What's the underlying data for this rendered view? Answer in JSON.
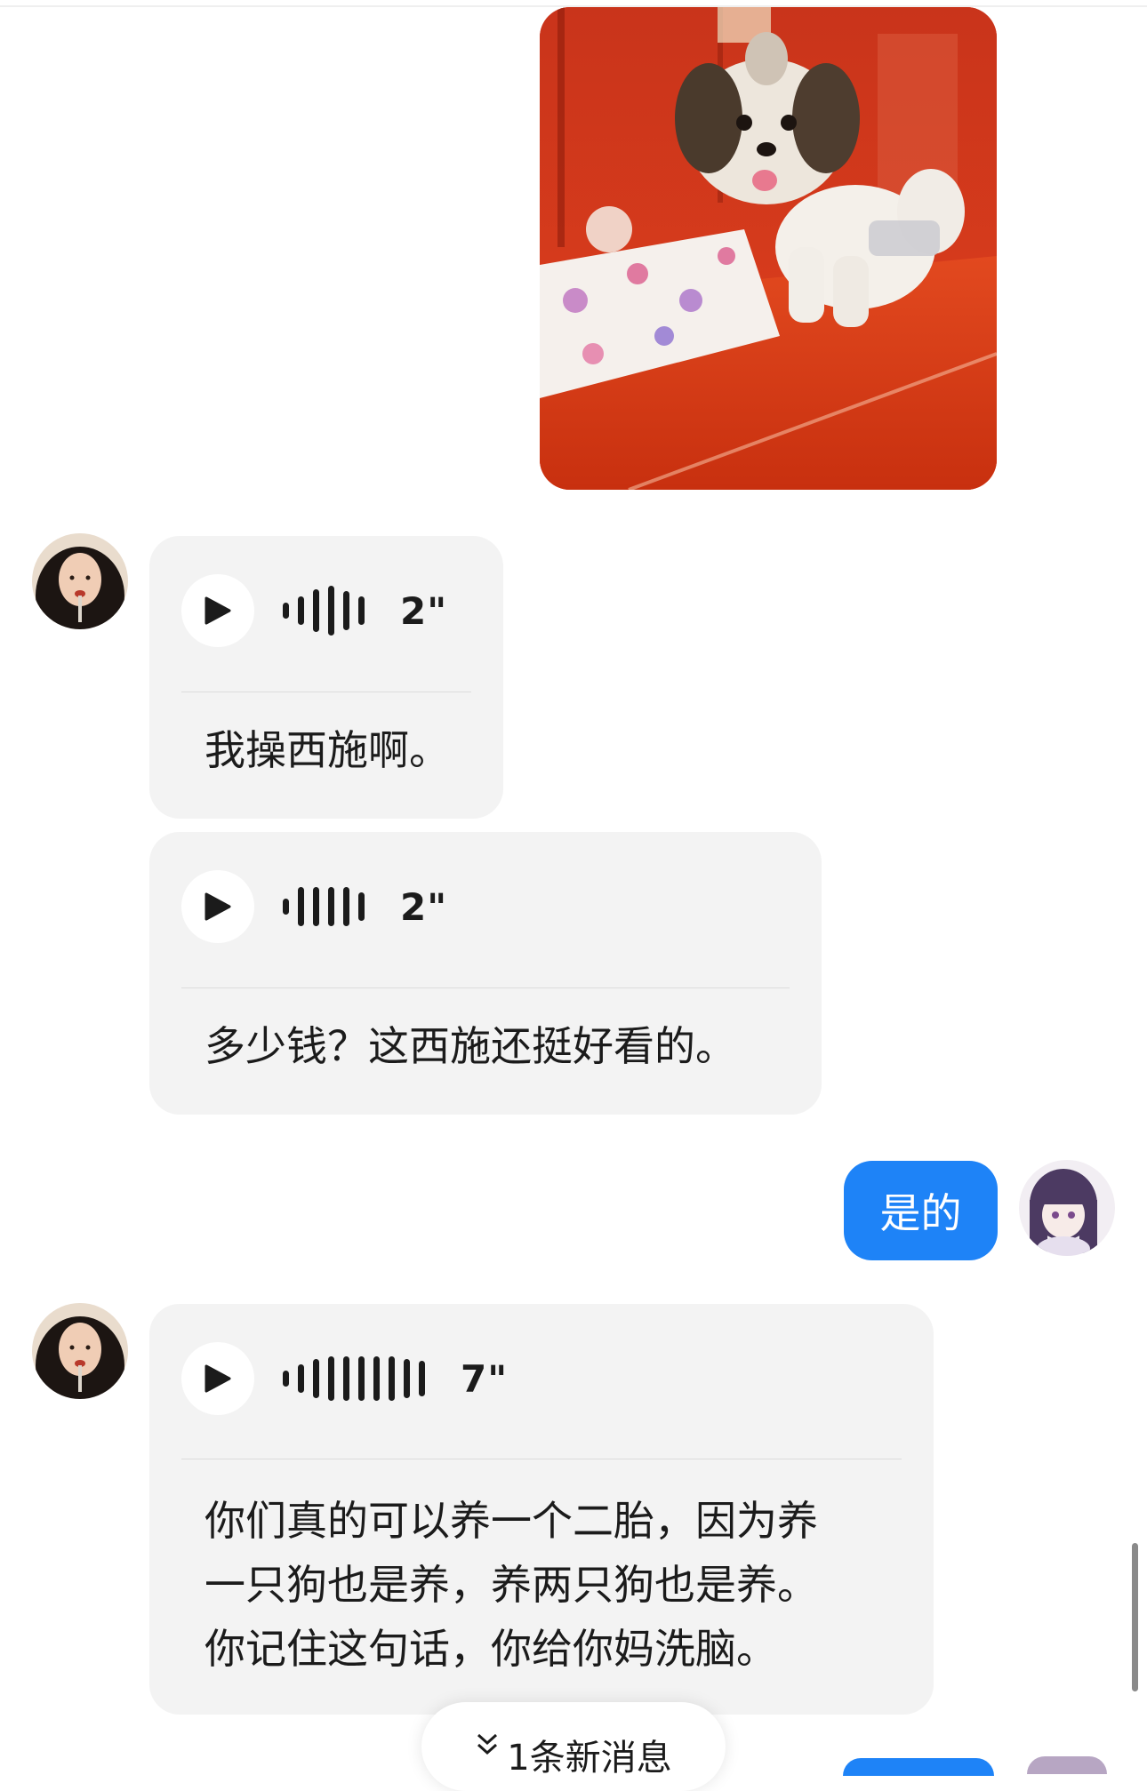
{
  "messages": [
    {
      "kind": "image",
      "sender": "self",
      "image_alt": "puppy-photo"
    },
    {
      "kind": "voice",
      "sender": "other",
      "duration": "2\"",
      "transcript": "我操西施啊。"
    },
    {
      "kind": "voice",
      "sender": "other",
      "duration": "2\"",
      "transcript": "多少钱？这西施还挺好看的。"
    },
    {
      "kind": "text",
      "sender": "self",
      "text": "是的"
    },
    {
      "kind": "voice",
      "sender": "other",
      "duration": "7\"",
      "transcript_lines": [
        "你们真的可以养一个二胎，因为养",
        "一只狗也是养，养两只狗也是养。",
        "你记住这句话，你给你妈洗脑。"
      ]
    }
  ],
  "new_message_indicator": {
    "icon": "double-chevron-down-icon",
    "label": "1条新消息"
  },
  "colors": {
    "outgoing_bubble": "#1e83f7",
    "incoming_bubble": "#f3f3f3",
    "text": "#1b1b1b"
  }
}
